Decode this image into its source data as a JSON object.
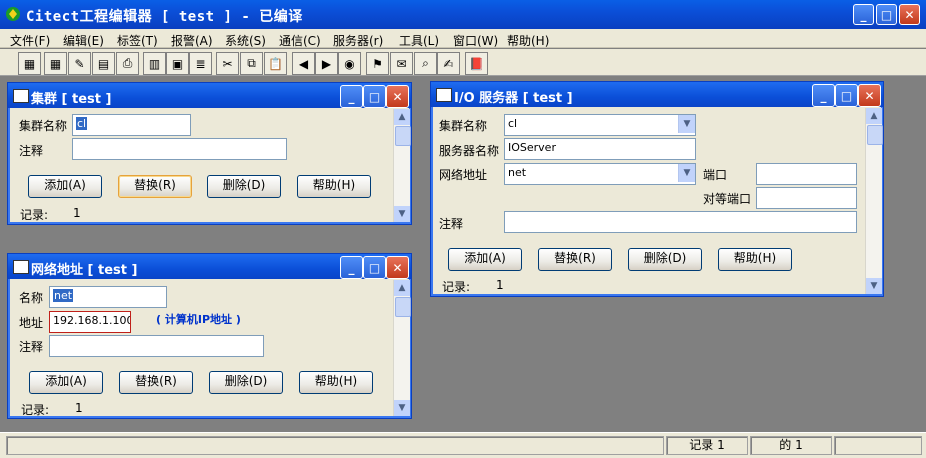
{
  "app": {
    "title": "Citect工程编辑器 [ test ] - 已编译"
  },
  "menu": [
    "文件(F)",
    "编辑(E)",
    "标签(T)",
    "报警(A)",
    "系统(S)",
    "通信(C)",
    "服务器(r)",
    "工具(L)",
    "窗口(W)",
    "帮助(H)"
  ],
  "cluster_win": {
    "title": "集群 [ test ]",
    "name_label": "集群名称",
    "name_value": "cl",
    "comment_label": "注释",
    "comment_value": "",
    "add": "添加(A)",
    "replace": "替换(R)",
    "delete": "删除(D)",
    "help": "帮助(H)",
    "record_label": "记录:",
    "record_value": "1"
  },
  "network_win": {
    "title": "网络地址 [ test ]",
    "name_label": "名称",
    "name_value": "net",
    "addr_label": "地址",
    "addr_value": "192.168.1.100",
    "annotation": "( 计算机IP地址 )",
    "comment_label": "注释",
    "comment_value": "",
    "add": "添加(A)",
    "replace": "替换(R)",
    "delete": "删除(D)",
    "help": "帮助(H)",
    "record_label": "记录:",
    "record_value": "1"
  },
  "io_win": {
    "title": "I/O 服务器 [ test ]",
    "cluster_label": "集群名称",
    "cluster_value": "cl",
    "server_label": "服务器名称",
    "server_value": "IOServer",
    "netaddr_label": "网络地址",
    "netaddr_value": "net",
    "port_label": "端口",
    "port_value": "",
    "peer_port_label": "对等端口",
    "peer_port_value": "",
    "comment_label": "注释",
    "comment_value": "",
    "add": "添加(A)",
    "replace": "替换(R)",
    "delete": "删除(D)",
    "help": "帮助(H)",
    "record_label": "记录:",
    "record_value": "1"
  },
  "statusbar": {
    "record": "记录 1",
    "of": "的 1"
  },
  "colors": {
    "title_blue": "#0b4fd8",
    "annotation_blue": "#0033cc",
    "highlight": "#316ac5"
  }
}
